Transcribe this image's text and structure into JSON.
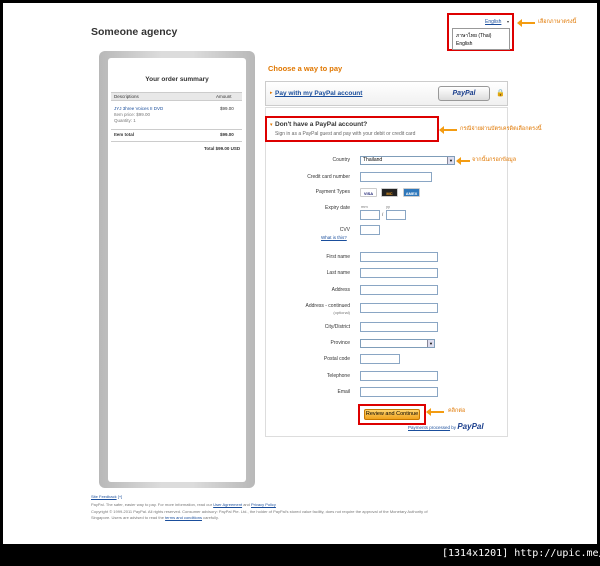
{
  "merchant": "Someone agency",
  "language": {
    "current": "English",
    "options": [
      "ภาษาไทย (Thai)",
      "English"
    ]
  },
  "annotations": {
    "language": "เลือกภาษาตรงนี้",
    "guest": "กรณีจ่ายผ่านบัตรเครดิตเลือกตรงนี้",
    "fill": "จากนั้นกรอกข้อมูล",
    "click": "คลิกต่อ"
  },
  "order_summary": {
    "title": "Your order summary",
    "headers": [
      "Descriptions",
      "Amount"
    ],
    "item": {
      "name": "JYJ 3hree Voices II DVD",
      "price_label": "Item price: $99.00",
      "quantity_label": "Quantity: 1",
      "amount": "$99.00"
    },
    "item_total_label": "Item total",
    "item_total": "$99.00",
    "total": "Total $99.00 USD"
  },
  "choose_title": "Choose a way to pay",
  "paypal_login": {
    "link": "Pay with my PayPal account",
    "logo": "PayPal"
  },
  "guest": {
    "title": "Don't have a PayPal account?",
    "subtitle": "Sign in as a PayPal guest and pay with your debit or credit card"
  },
  "form": {
    "country_label": "Country",
    "country_value": "Thailand",
    "card_number_label": "Credit card number",
    "payment_types_label": "Payment Types",
    "card_types": [
      "VISA",
      "MC",
      "AMEX"
    ],
    "expiry_label": "Expiry date",
    "expiry_mm": "mm",
    "expiry_yy": "yy",
    "expiry_sep": "/",
    "cvv_label": "CVV",
    "cvv_help": "What is this?",
    "first_name_label": "First name",
    "last_name_label": "Last name",
    "address_label": "Address",
    "address2_label": "Address - continued",
    "address2_hint": "(optional)",
    "city_label": "City/District",
    "province_label": "Province",
    "postal_label": "Postal code",
    "telephone_label": "Telephone",
    "email_label": "Email"
  },
  "review_button": "Review and Continue",
  "processed": {
    "prefix": "Payments processed",
    "by": "by",
    "logo": "PayPal"
  },
  "footer": {
    "feedback": "Site Feedback",
    "feedback_mark": "[+]",
    "line1_pre": "PayPal. The safer, easier way to pay. For more information, read our",
    "user_agreement": "User Agreement",
    "and": "and",
    "privacy": "Privacy Policy",
    "line2": "Copyright © 1999-2011 PayPal. All rights reserved. Consumer advisory: PayPal Pte. Ltd., the holder of PayPal's stored value facility, does not require the approval of the Monetary Authority of",
    "line3_pre": "Singapore. Users are advised to read the",
    "terms": "terms and conditions",
    "line3_post": "carefully."
  },
  "watermark": "[1314x1201] http://upic.me/",
  "colors": {
    "accent": "#e07700",
    "highlight": "#dd0000",
    "link": "#1a4e9c"
  }
}
